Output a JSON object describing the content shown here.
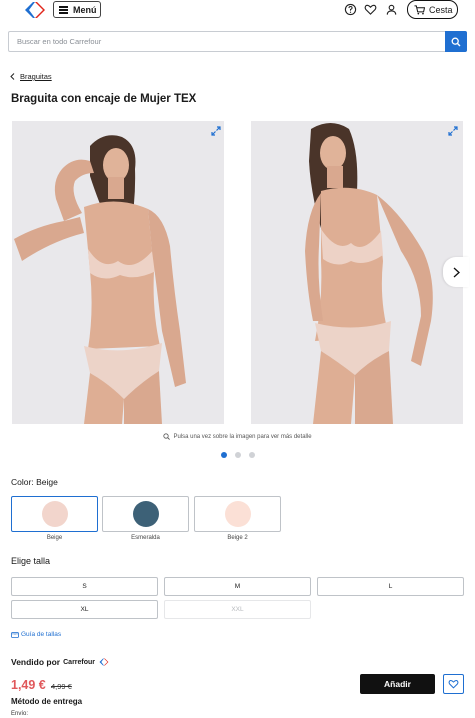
{
  "header": {
    "menu_label": "Menú",
    "basket_label": "Cesta",
    "icons": [
      "carrefour-logo",
      "help-icon",
      "heart-icon",
      "user-icon",
      "cart-icon"
    ],
    "brand_colors": {
      "blue": "#1f6fd1",
      "red": "#e1251b"
    }
  },
  "search": {
    "placeholder": "Buscar en todo Carrefour",
    "value": ""
  },
  "breadcrumb": {
    "label": "Braguitas"
  },
  "product": {
    "title": "Braguita con encaje de Mujer TEX",
    "zoom_hint": "Pulsa una vez sobre la imagen para ver más detalle",
    "images_count": 3,
    "active_image": 1,
    "color_label": "Color:",
    "color_selected": "Beige",
    "colors": [
      {
        "name": "Beige",
        "hex": "#f2d5cc"
      },
      {
        "name": "Esmeralda",
        "hex": "#3d6177"
      },
      {
        "name": "Beige 2",
        "hex": "#fbe0d6"
      }
    ],
    "size_label": "Elige talla",
    "sizes": [
      {
        "label": "S",
        "available": true
      },
      {
        "label": "M",
        "available": true
      },
      {
        "label": "L",
        "available": true
      },
      {
        "label": "XL",
        "available": true
      },
      {
        "label": "XXL",
        "available": false
      }
    ],
    "size_guide": "Guía de tallas",
    "seller_prefix": "Vendido por",
    "seller_name": "Carrefour",
    "price": "1,49 €",
    "old_price": "4,99 €",
    "price_color": "#e0585b",
    "add_label": "Añadir",
    "delivery_title": "Método de entrega",
    "shipping_label": "Envío:"
  }
}
